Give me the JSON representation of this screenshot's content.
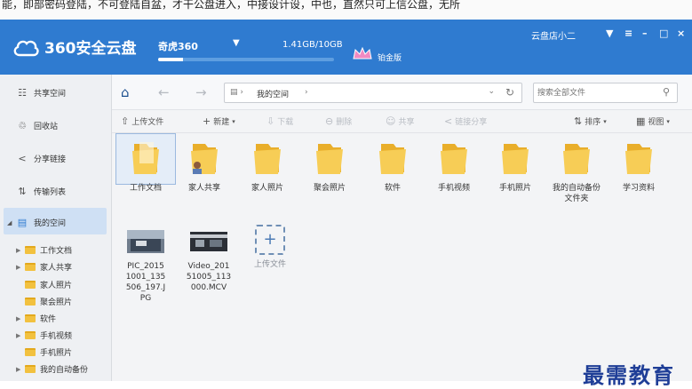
{
  "top_text": "能，即部密码登陆，不可登陆自盆，才干公盘进入，中接设计设，中也，直然只可上信公盘，无所",
  "app": {
    "logo_text": "360安全云盘",
    "user_name": "奇虎360",
    "quota_text": "1.41GB/10GB",
    "quota_used_fraction": 0.141,
    "vip_label": "铂金版",
    "account_name": "云盘店小二",
    "accent_color": "#2f7bd0"
  },
  "window_controls": [
    "▼",
    "≡",
    "–",
    "□",
    "×"
  ],
  "sidebar": {
    "items": [
      {
        "icon": "shared-space-icon",
        "label": "共享空间"
      },
      {
        "icon": "recycle-bin-icon",
        "label": "回收站"
      },
      {
        "icon": "share-link-icon",
        "label": "分享链接"
      },
      {
        "icon": "transfer-list-icon",
        "label": "传输列表"
      },
      {
        "icon": "my-space-icon",
        "label": "我的空间"
      }
    ],
    "tree": [
      {
        "label": "工作文档",
        "expandable": true
      },
      {
        "label": "家人共享",
        "expandable": true
      },
      {
        "label": "家人照片",
        "expandable": false
      },
      {
        "label": "聚会照片",
        "expandable": false
      },
      {
        "label": "软件",
        "expandable": true
      },
      {
        "label": "手机视频",
        "expandable": true
      },
      {
        "label": "手机照片",
        "expandable": false
      },
      {
        "label": "我的自动备份",
        "expandable": true
      }
    ]
  },
  "nav": {
    "path_label": "我的空间",
    "search_placeholder": "搜索全部文件"
  },
  "toolbar": {
    "upload": "上传文件",
    "new": "新建",
    "download": "下载",
    "delete": "删除",
    "share": "共享",
    "link_share": "链接分享",
    "sort": "排序",
    "view": "视图"
  },
  "files": [
    {
      "name": "工作文档",
      "type": "folder"
    },
    {
      "name": "家人共享",
      "type": "shared-folder"
    },
    {
      "name": "家人照片",
      "type": "folder"
    },
    {
      "name": "聚会照片",
      "type": "folder"
    },
    {
      "name": "软件",
      "type": "folder"
    },
    {
      "name": "手机视频",
      "type": "folder"
    },
    {
      "name": "手机照片",
      "type": "folder"
    },
    {
      "name": "我的自动备份文件夹",
      "type": "folder"
    },
    {
      "name": "学习资料",
      "type": "folder"
    }
  ],
  "media_files": [
    {
      "name": "PIC_20151001_135506_197.JPG",
      "type": "image"
    },
    {
      "name": "Video_20151005_113000.MCV",
      "type": "video"
    }
  ],
  "upload_tile_label": "上传文件",
  "watermark": "最需教育"
}
